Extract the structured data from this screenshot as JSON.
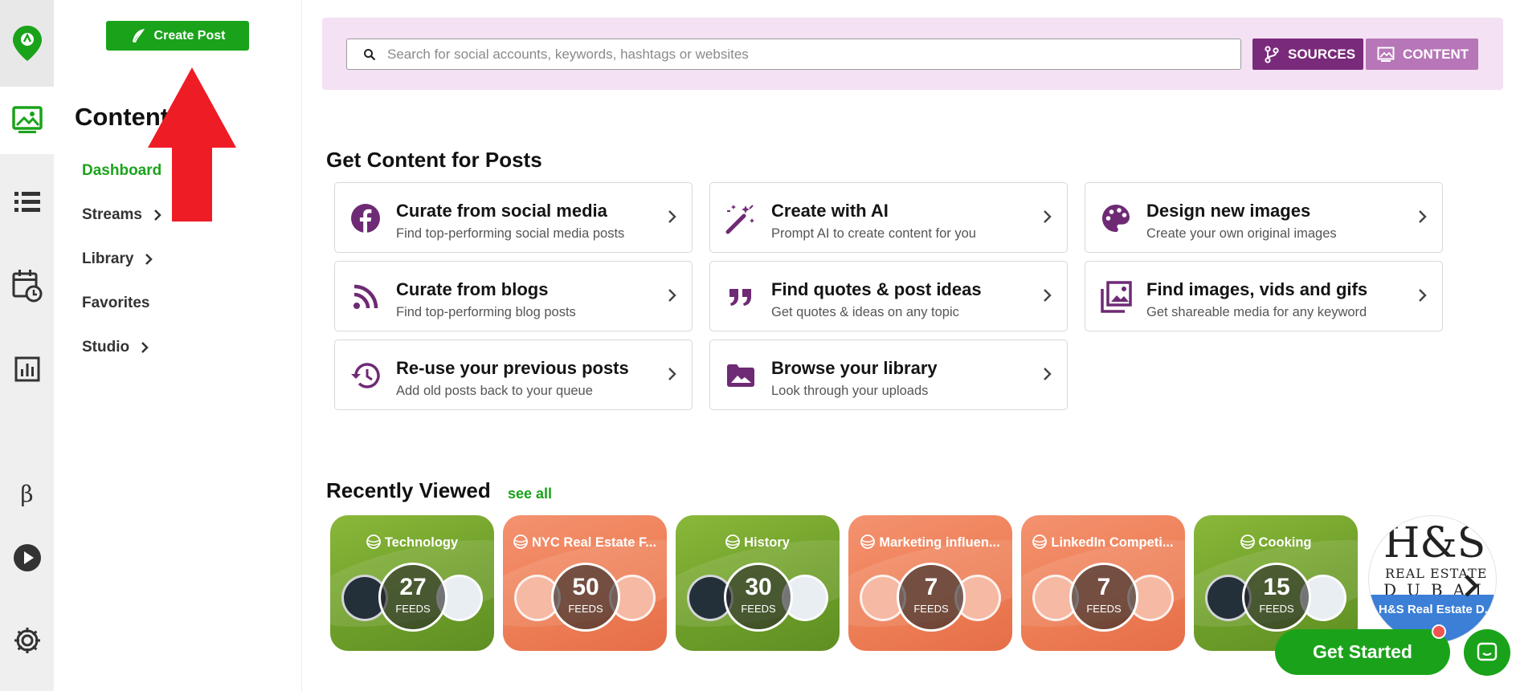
{
  "colors": {
    "brand_green": "#1aa31a",
    "purple_dark": "#7a2a7a",
    "purple_light": "#b776b7",
    "banner_bg": "#f4e1f4",
    "icon_purple": "#6e2a74",
    "annotation_red": "#ee1c25"
  },
  "rail": {
    "icons": [
      "location-pin-logo-icon",
      "content-image-icon",
      "list-icon",
      "calendar-clock-icon",
      "bar-chart-icon",
      "beta-icon",
      "play-icon",
      "gear-icon"
    ],
    "beta_label": "β"
  },
  "nav": {
    "create_post_label": "Create Post",
    "title": "Content",
    "items": [
      {
        "label": "Dashboard",
        "active": true,
        "has_chevron": false
      },
      {
        "label": "Streams",
        "active": false,
        "has_chevron": true
      },
      {
        "label": "Library",
        "active": false,
        "has_chevron": true
      },
      {
        "label": "Favorites",
        "active": false,
        "has_chevron": false
      },
      {
        "label": "Studio",
        "active": false,
        "has_chevron": true
      }
    ]
  },
  "search": {
    "placeholder": "Search for social accounts, keywords, hashtags or websites",
    "value": ""
  },
  "toggle": {
    "sources_label": "SOURCES",
    "content_label": "CONTENT"
  },
  "get_content": {
    "heading": "Get Content for Posts",
    "cards": [
      {
        "title": "Curate from social media",
        "subtitle": "Find top-performing social media posts",
        "icon": "facebook-icon"
      },
      {
        "title": "Create with AI",
        "subtitle": "Prompt AI to create content for you",
        "icon": "magic-wand-icon"
      },
      {
        "title": "Design new images",
        "subtitle": "Create your own original images",
        "icon": "palette-icon"
      },
      {
        "title": "Curate from blogs",
        "subtitle": "Find top-performing blog posts",
        "icon": "rss-icon"
      },
      {
        "title": "Find quotes & post ideas",
        "subtitle": "Get quotes & ideas on any topic",
        "icon": "quote-icon"
      },
      {
        "title": "Find images, vids and gifs",
        "subtitle": "Get shareable media for any keyword",
        "icon": "image-library-icon"
      },
      {
        "title": "Re-use your previous posts",
        "subtitle": "Add old posts back to your queue",
        "icon": "history-icon"
      },
      {
        "title": "Browse your library",
        "subtitle": "Look through your uploads",
        "icon": "photo-folder-icon"
      }
    ]
  },
  "recently_viewed": {
    "heading": "Recently Viewed",
    "see_all_label": "see all",
    "tiles": [
      {
        "name": "Technology",
        "count": "27",
        "unit": "FEEDS",
        "theme": "green"
      },
      {
        "name": "NYC Real Estate F...",
        "count": "50",
        "unit": "FEEDS",
        "theme": "orange"
      },
      {
        "name": "History",
        "count": "30",
        "unit": "FEEDS",
        "theme": "green"
      },
      {
        "name": "Marketing influen...",
        "count": "7",
        "unit": "FEEDS",
        "theme": "orange"
      },
      {
        "name": "LinkedIn Competi...",
        "count": "7",
        "unit": "FEEDS",
        "theme": "orange"
      },
      {
        "name": "Cooking",
        "count": "15",
        "unit": "FEEDS",
        "theme": "green"
      }
    ],
    "last_tile": {
      "logo_text": "H&S",
      "logo_line2": "REAL ESTATE",
      "logo_line3": "DUBAI",
      "name": "H&S Real Estate D..."
    }
  },
  "cta": {
    "get_started_label": "Get Started"
  }
}
